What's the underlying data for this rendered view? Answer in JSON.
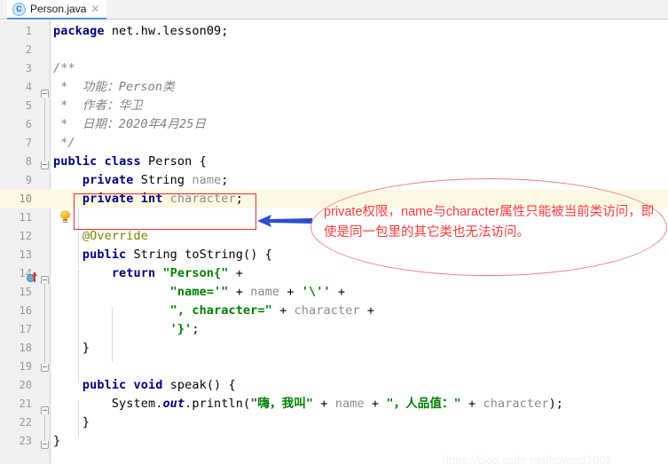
{
  "tab": {
    "file_icon": "java-class-icon",
    "label": "Person.java",
    "close_label": "✕"
  },
  "editor": {
    "current_line": 10,
    "lines": [
      {
        "n": "1",
        "text": "package net.hw.lesson09;"
      },
      {
        "n": "2",
        "text": ""
      },
      {
        "n": "3",
        "text": "/**"
      },
      {
        "n": "4",
        "text": " *  功能：Person类"
      },
      {
        "n": "5",
        "text": " *  作者：华卫"
      },
      {
        "n": "6",
        "text": " *  日期：2020年4月25日"
      },
      {
        "n": "7",
        "text": " */"
      },
      {
        "n": "8",
        "text": "public class Person {"
      },
      {
        "n": "9",
        "text": "    private String name;"
      },
      {
        "n": "10",
        "text": "    private int character;"
      },
      {
        "n": "11",
        "text": ""
      },
      {
        "n": "12",
        "text": "    @Override"
      },
      {
        "n": "13",
        "text": "    public String toString() {"
      },
      {
        "n": "14",
        "text": "        return \"Person{\" +"
      },
      {
        "n": "15",
        "text": "                \"name='\" + name + '\\'' +"
      },
      {
        "n": "16",
        "text": "                \", character=\" + character +"
      },
      {
        "n": "17",
        "text": "                '}';"
      },
      {
        "n": "18",
        "text": "    }"
      },
      {
        "n": "19",
        "text": ""
      },
      {
        "n": "20",
        "text": "    public void speak() {"
      },
      {
        "n": "21",
        "text": "        System.out.println(\"嗨，我叫\" + name + \"，人品值：\" + character);"
      },
      {
        "n": "22",
        "text": "    }"
      },
      {
        "n": "23",
        "text": "}"
      }
    ]
  },
  "gutter_icons": {
    "lightbulb_line": "10",
    "override_marker_line": "13"
  },
  "annotations": {
    "note_text": "private权限，name与character属性只能被当前类访问，即使是同一包里的其它类也无法访问。",
    "note_color": "#ff3b3b",
    "ellipse_color": "#f08080",
    "box_color": "#e03030",
    "arrow_color": "#2b4fd0"
  },
  "watermark": {
    "text": "https://blog.csdn.net/howard2005"
  }
}
